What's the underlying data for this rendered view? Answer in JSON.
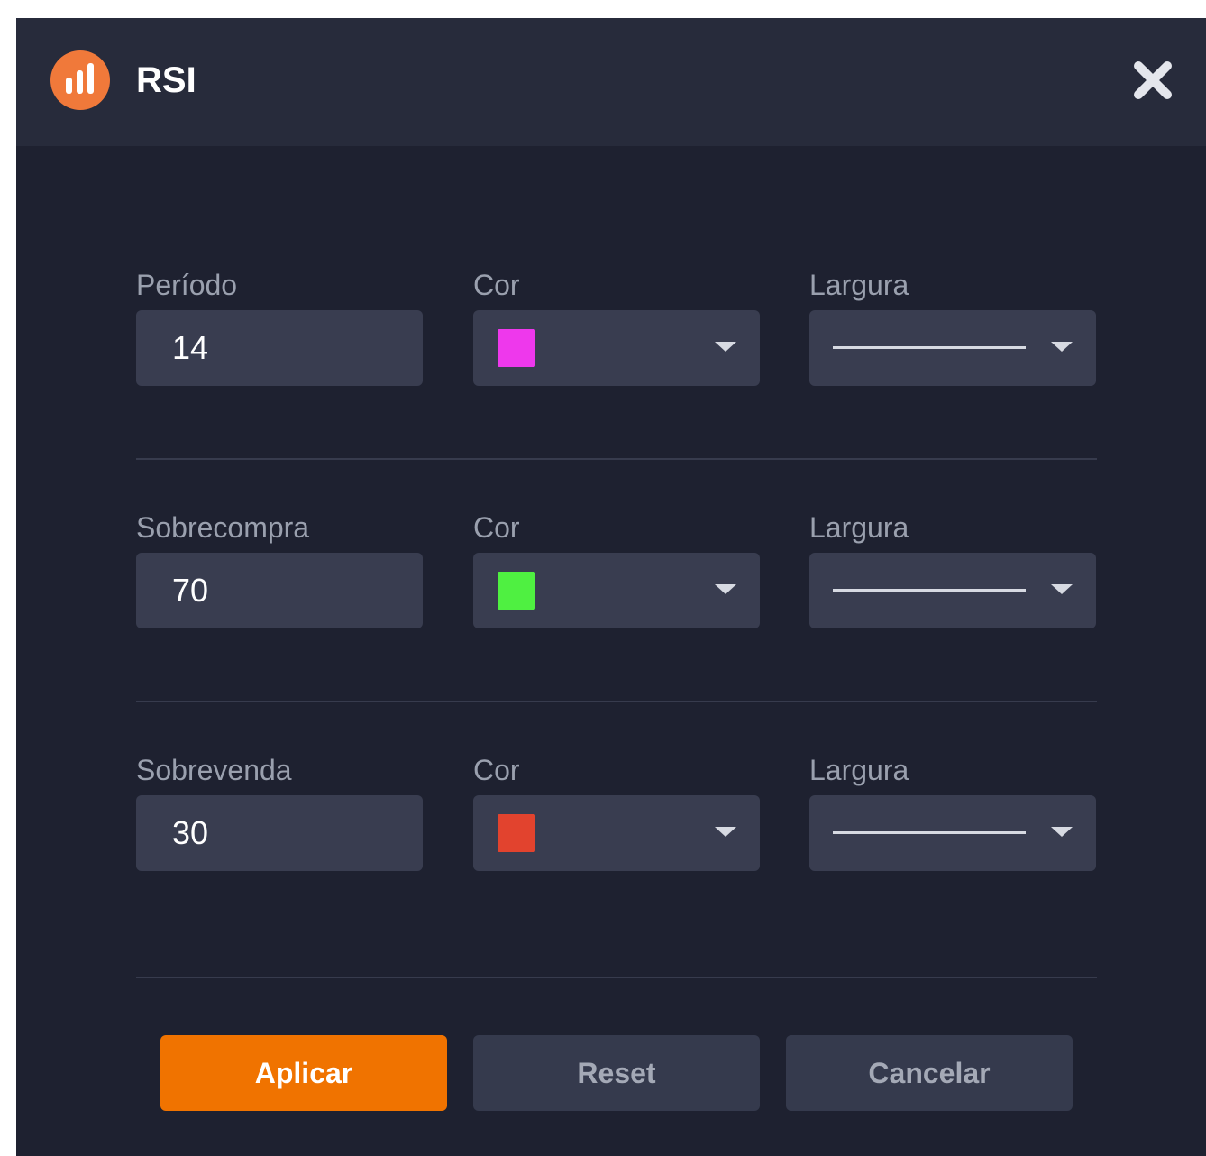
{
  "dialog": {
    "title": "RSI",
    "icon": "bar-chart-icon",
    "close_icon": "close-icon"
  },
  "rows": [
    {
      "name_label": "Período",
      "value": "14",
      "color_label": "Cor",
      "color": "#ee38ec",
      "width_label": "Largura"
    },
    {
      "name_label": "Sobrecompra",
      "value": "70",
      "color_label": "Cor",
      "color": "#4ff041",
      "width_label": "Largura"
    },
    {
      "name_label": "Sobrevenda",
      "value": "30",
      "color_label": "Cor",
      "color": "#e2432e",
      "width_label": "Largura"
    }
  ],
  "buttons": {
    "apply": "Aplicar",
    "reset": "Reset",
    "cancel": "Cancelar"
  },
  "colors": {
    "accent": "#f07300",
    "background": "#1e2130",
    "titlebar": "#272b3b",
    "field": "#393d50"
  }
}
